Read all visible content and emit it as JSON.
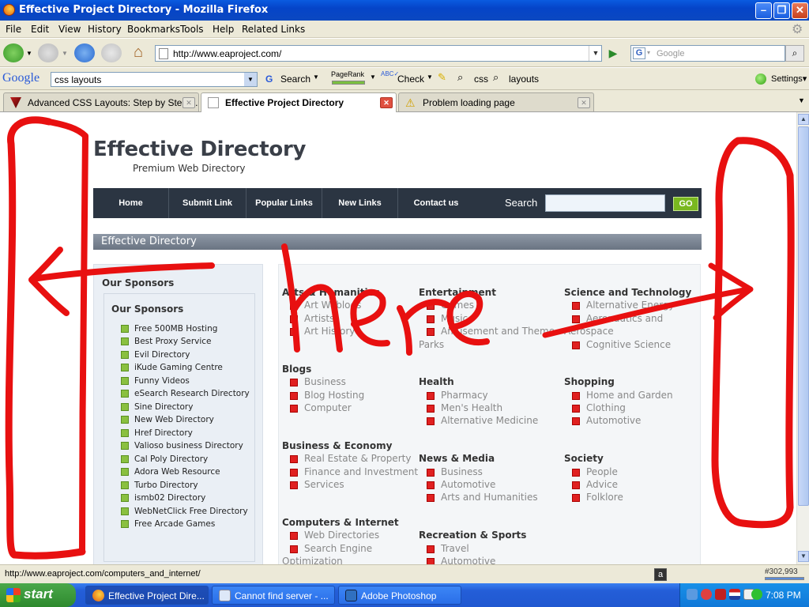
{
  "window": {
    "title": "Effective Project Directory - Mozilla Firefox"
  },
  "menu": [
    "File",
    "Edit",
    "View",
    "History",
    "Bookmarks",
    "Tools",
    "Help",
    "Related Links"
  ],
  "nav": {
    "url": "http://www.eaproject.com/",
    "search_placeholder": "Google"
  },
  "gtoolbar": {
    "logo": "Google",
    "query": "css layouts",
    "search": "Search",
    "pagerank": "PageRank",
    "check": "Check",
    "term1": "css",
    "term2": "layouts",
    "settings": "Settings▾"
  },
  "tabs": [
    {
      "label": "Advanced CSS Layouts: Step by Step ..."
    },
    {
      "label": "Effective Project Directory"
    },
    {
      "label": "Problem loading page"
    }
  ],
  "site": {
    "title": "Effective Directory",
    "subtitle": "Premium Web Directory",
    "nav": [
      "Home",
      "Submit Link",
      "Popular Links",
      "New Links",
      "Contact us"
    ],
    "search_label": "Search",
    "go": "GO",
    "crumb": "Effective Directory"
  },
  "sidebar": {
    "heading": "Our Sponsors",
    "box_heading": "Our Sponsors",
    "items": [
      "Free 500MB Hosting",
      "Best Proxy Service",
      "Evil Directory",
      "iKude Gaming Centre",
      "Funny Videos",
      "eSearch Research Directory",
      "Sine Directory",
      "New Web Directory",
      "Href Directory",
      "Valioso business Directory",
      "Cal Poly Directory",
      "Adora Web Resource",
      "Turbo Directory",
      "ismb02 Directory",
      "WebNetClick Free Directory",
      "Free Arcade Games"
    ]
  },
  "categories": {
    "arts": {
      "title": "Arts & Humanities",
      "items": [
        "Art Weblogs",
        "Artists",
        "Art History"
      ]
    },
    "entertainment": {
      "title": "Entertainment",
      "items": [
        "Games",
        "Music",
        "Amusement and Theme",
        "Parks"
      ]
    },
    "science": {
      "title": "Science and Technology",
      "items": [
        "Alternative Energy",
        "Aeronautics and",
        "Aerospace",
        "Cognitive Science"
      ]
    },
    "blogs": {
      "title": "Blogs",
      "items": [
        "Business",
        "Blog Hosting",
        "Computer"
      ]
    },
    "health": {
      "title": "Health",
      "items": [
        "Pharmacy",
        "Men's Health",
        "Alternative Medicine"
      ]
    },
    "shopping": {
      "title": "Shopping",
      "items": [
        "Home and Garden",
        "Clothing",
        "Automotive"
      ]
    },
    "business": {
      "title": "Business & Economy",
      "items": [
        "Real Estate & Property",
        "Finance and Investment",
        "Services"
      ]
    },
    "news": {
      "title": "News & Media",
      "items": [
        "Business",
        "Automotive",
        "Arts and Humanities"
      ]
    },
    "society": {
      "title": "Society",
      "items": [
        "People",
        "Advice",
        "Folklore"
      ]
    },
    "computers": {
      "title": "Computers & Internet",
      "items": [
        "Web Directories",
        "Search Engine",
        "Optimization"
      ]
    },
    "recreation": {
      "title": "Recreation & Sports",
      "items": [
        "Travel",
        "Automotive"
      ]
    }
  },
  "annotation": {
    "text": "here",
    "color": "#e81010"
  },
  "status": {
    "text": "http://www.eaproject.com/computers_and_internet/",
    "pagerank": "#302,993"
  },
  "taskbar": {
    "start": "start",
    "tasks": [
      "Effective Project Dire...",
      "Cannot find server - ...",
      "Adobe Photoshop"
    ],
    "clock": "7:08 PM"
  }
}
